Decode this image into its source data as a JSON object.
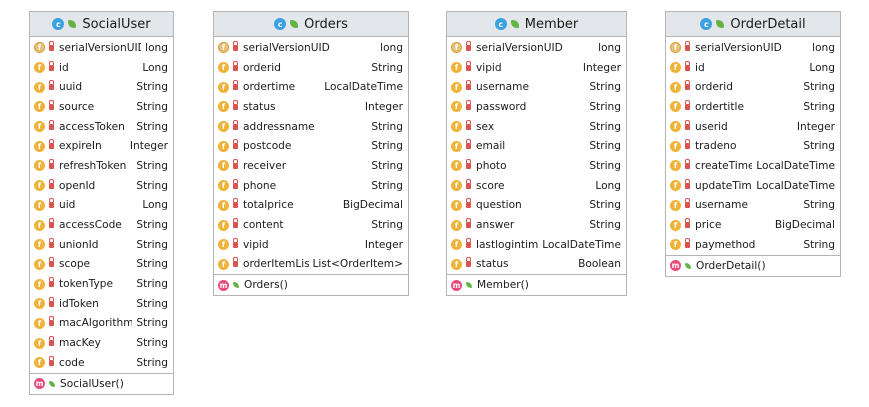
{
  "classes": [
    {
      "name": "SocialUser",
      "fields": [
        {
          "name": "serialVersionUID",
          "type": "long",
          "static": true
        },
        {
          "name": "id",
          "type": "Long"
        },
        {
          "name": "uuid",
          "type": "String"
        },
        {
          "name": "source",
          "type": "String"
        },
        {
          "name": "accessToken",
          "type": "String"
        },
        {
          "name": "expireIn",
          "type": "Integer"
        },
        {
          "name": "refreshToken",
          "type": "String"
        },
        {
          "name": "openId",
          "type": "String"
        },
        {
          "name": "uid",
          "type": "Long"
        },
        {
          "name": "accessCode",
          "type": "String"
        },
        {
          "name": "unionId",
          "type": "String"
        },
        {
          "name": "scope",
          "type": "String"
        },
        {
          "name": "tokenType",
          "type": "String"
        },
        {
          "name": "idToken",
          "type": "String"
        },
        {
          "name": "macAlgorithm",
          "type": "String"
        },
        {
          "name": "macKey",
          "type": "String"
        },
        {
          "name": "code",
          "type": "String"
        }
      ],
      "methods": [
        "SocialUser()"
      ]
    },
    {
      "name": "Orders",
      "fields": [
        {
          "name": "serialVersionUID",
          "type": "long",
          "static": true
        },
        {
          "name": "orderid",
          "type": "String"
        },
        {
          "name": "ordertime",
          "type": "LocalDateTime"
        },
        {
          "name": "status",
          "type": "Integer"
        },
        {
          "name": "addressname",
          "type": "String"
        },
        {
          "name": "postcode",
          "type": "String"
        },
        {
          "name": "receiver",
          "type": "String"
        },
        {
          "name": "phone",
          "type": "String"
        },
        {
          "name": "totalprice",
          "type": "BigDecimal"
        },
        {
          "name": "content",
          "type": "String"
        },
        {
          "name": "vipid",
          "type": "Integer"
        },
        {
          "name": "orderItemList",
          "type": "List<OrderItem>"
        }
      ],
      "methods": [
        "Orders()"
      ]
    },
    {
      "name": "Member",
      "fields": [
        {
          "name": "serialVersionUID",
          "type": "long",
          "static": true
        },
        {
          "name": "vipid",
          "type": "Integer"
        },
        {
          "name": "username",
          "type": "String"
        },
        {
          "name": "password",
          "type": "String"
        },
        {
          "name": "sex",
          "type": "String"
        },
        {
          "name": "email",
          "type": "String"
        },
        {
          "name": "photo",
          "type": "String"
        },
        {
          "name": "score",
          "type": "Long"
        },
        {
          "name": "question",
          "type": "String"
        },
        {
          "name": "answer",
          "type": "String"
        },
        {
          "name": "lastlogintime",
          "type": "LocalDateTime"
        },
        {
          "name": "status",
          "type": "Boolean"
        }
      ],
      "methods": [
        "Member()"
      ]
    },
    {
      "name": "OrderDetail",
      "fields": [
        {
          "name": "serialVersionUID",
          "type": "long",
          "static": true
        },
        {
          "name": "id",
          "type": "Long"
        },
        {
          "name": "orderid",
          "type": "String"
        },
        {
          "name": "ordertitle",
          "type": "String"
        },
        {
          "name": "userid",
          "type": "Integer"
        },
        {
          "name": "tradeno",
          "type": "String"
        },
        {
          "name": "createTime",
          "type": "LocalDateTime"
        },
        {
          "name": "updateTime",
          "type": "LocalDateTime"
        },
        {
          "name": "username",
          "type": "String"
        },
        {
          "name": "price",
          "type": "BigDecimal"
        },
        {
          "name": "paymethod",
          "type": "String"
        }
      ],
      "methods": [
        "OrderDetail()"
      ]
    }
  ],
  "icons": {
    "class": "class-c-icon",
    "field": "field-f-icon",
    "method": "method-m-icon",
    "private": "lock-icon",
    "public": "leaf-icon"
  },
  "colors": {
    "header_bg": "#e3e6ea",
    "border": "#b5b5b5",
    "class_icon": "#3aa2e2",
    "field_icon": "#f0b33a",
    "method_icon": "#e94a7a",
    "private_lock": "#d9534f",
    "public_leaf": "#62b543"
  }
}
